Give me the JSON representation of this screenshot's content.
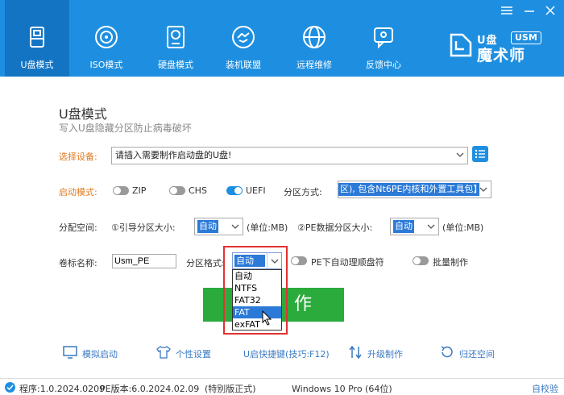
{
  "nav": [
    {
      "label": "U盘模式",
      "icon": "usb-drive-icon"
    },
    {
      "label": "ISO模式",
      "icon": "disc-icon"
    },
    {
      "label": "硬盘模式",
      "icon": "hard-disk-icon"
    },
    {
      "label": "装机联盟",
      "icon": "handshake-icon"
    },
    {
      "label": "远程维修",
      "icon": "globe-icon"
    },
    {
      "label": "反馈中心",
      "icon": "feedback-icon"
    }
  ],
  "logo": {
    "top": "U盘",
    "badge": "USM",
    "bottom": "魔术师"
  },
  "main": {
    "title": "U盘模式",
    "subtitle": "写入U盘隐藏分区防止病毒破坏",
    "device_label": "选择设备:",
    "device_value": "请插入需要制作启动盘的U盘!",
    "boot_mode_label": "启动模式:",
    "boot_modes": [
      {
        "label": "ZIP",
        "on": false
      },
      {
        "label": "CHS",
        "on": false
      },
      {
        "label": "UEFI",
        "on": true
      }
    ],
    "partition_mode_label": "分区方式:",
    "partition_mode_value": "区), 包含Nt6PE内核和外置工具包】",
    "alloc_label": "分配空间:",
    "boot_size_label": "①引导分区大小:",
    "boot_size_value": "自动",
    "boot_size_unit": "(单位:MB)",
    "pe_size_label": "②PE数据分区大小:",
    "pe_size_value": "自动",
    "pe_size_unit": "(单位:MB)",
    "volume_label": "卷标名称:",
    "volume_value": "Usm_PE",
    "format_label": "分区格式:",
    "format_value": "自动",
    "format_options": [
      "自动",
      "NTFS",
      "FAT32",
      "FAT",
      "exFAT"
    ],
    "format_highlighted": "FAT",
    "auto_sort_label": "PE下自动理顺盘符",
    "batch_label": "批量制作",
    "make_label": "制 作"
  },
  "tools": [
    {
      "label": "模拟启动",
      "icon": "monitor-icon"
    },
    {
      "label": "个性设置",
      "icon": "shirt-icon"
    },
    {
      "label": "U启快捷键(技巧:F12)",
      "icon": ""
    },
    {
      "label": "升级制作",
      "icon": "upgrade-icon"
    },
    {
      "label": "归还空间",
      "icon": "restore-icon"
    }
  ],
  "status": {
    "program": "程序:1.0.2024.0209",
    "pe_version": "PE版本:6.0.2024.02.09",
    "edition": "(特别版正式)",
    "os": "Windows 10 Pro (64位)",
    "self_check": "自校验"
  },
  "colors": {
    "header": "#1e8fe0",
    "accent_orange": "#e07a1f",
    "make_green": "#2bab3c",
    "highlight": "#e23232"
  }
}
